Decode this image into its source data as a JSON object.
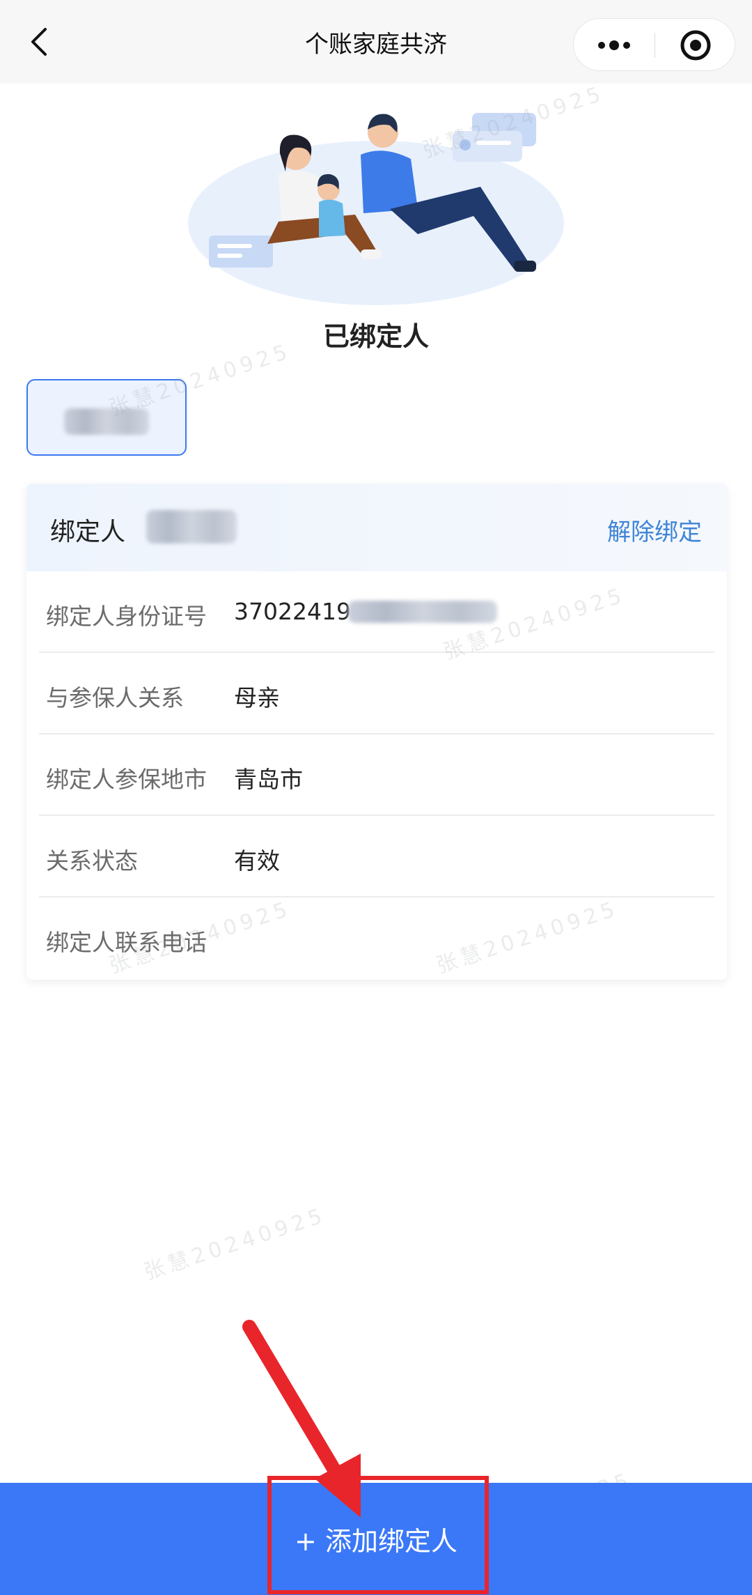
{
  "header": {
    "title": "个账家庭共济",
    "back_icon": "chevron-left-icon",
    "more_icon": "more-dots-icon",
    "close_icon": "target-icon"
  },
  "section_title": "已绑定人",
  "card": {
    "header_label": "绑定人",
    "unbind_label": "解除绑定",
    "rows": [
      {
        "label": "绑定人身份证号",
        "value": "37022419"
      },
      {
        "label": "与参保人关系",
        "value": "母亲"
      },
      {
        "label": "绑定人参保地市",
        "value": "青岛市"
      },
      {
        "label": "关系状态",
        "value": "有效"
      },
      {
        "label": "绑定人联系电话",
        "value": ""
      }
    ]
  },
  "bottom": {
    "add_label": "+ 添加绑定人"
  },
  "watermark": "张慧20240925",
  "colors": {
    "accent": "#3a78f7",
    "link": "#3f84d6",
    "highlight": "#e8252b"
  }
}
